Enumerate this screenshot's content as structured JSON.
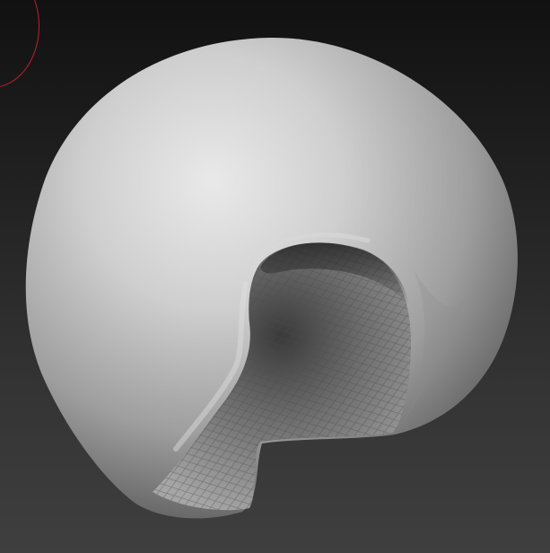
{
  "viewport": {
    "background_top": "#111111",
    "background_bottom": "#3f3f3f"
  },
  "brush": {
    "color": "#c0202a",
    "icon": "brush-radius-circle"
  },
  "model": {
    "material_color": "#bdbdbd",
    "shape": "sculpted-sphere-with-cavity"
  }
}
